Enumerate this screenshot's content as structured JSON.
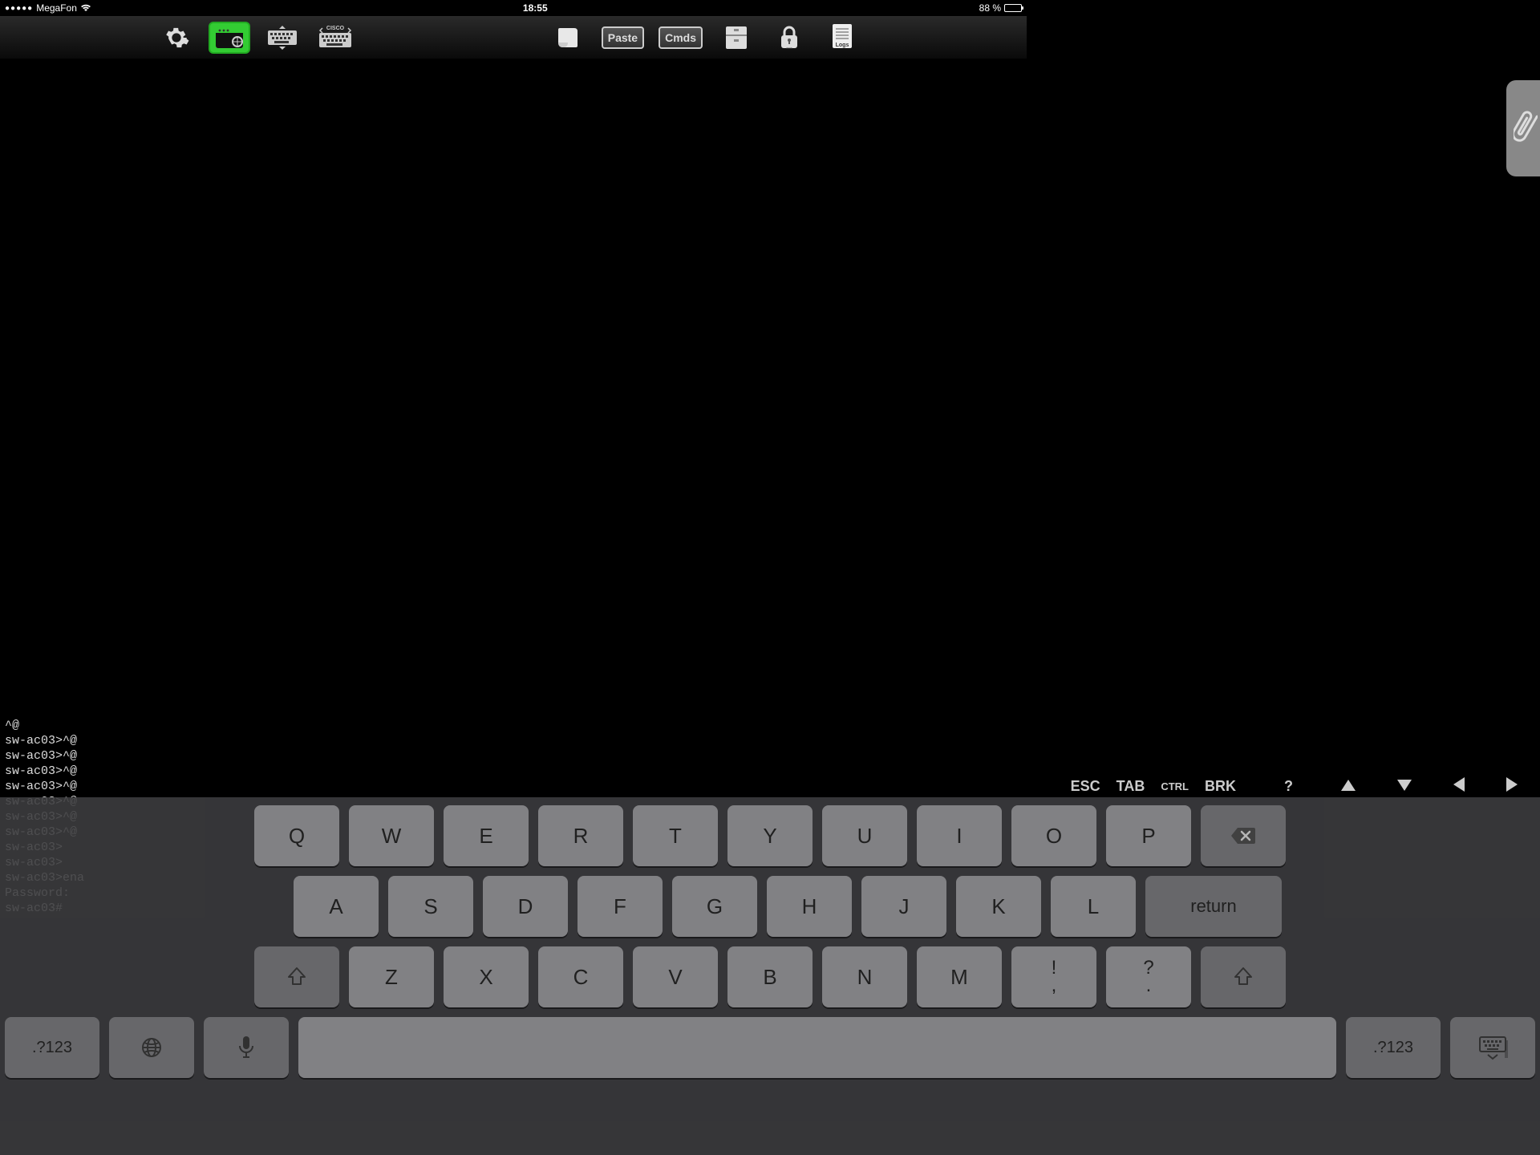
{
  "status": {
    "signal_dots": "●●●●●",
    "carrier": "MegaFon",
    "time": "18:55",
    "battery_pct": "88 %"
  },
  "toolbar": {
    "gear": "settings",
    "terminal": "terminal-session",
    "kbd1": "keyboard",
    "kbd2": "CISCO",
    "script": "script",
    "paste": "Paste",
    "cmds": "Cmds",
    "files": "files",
    "lock": "lock",
    "logs": "Logs"
  },
  "extra_keys": {
    "esc": "ESC",
    "tab": "TAB",
    "ctrl": "CTRL",
    "brk": "BRK",
    "q": "?"
  },
  "terminal_lines": [
    "^@",
    "sw-ac03>^@",
    "sw-ac03>^@",
    "sw-ac03>^@",
    "sw-ac03>^@",
    "sw-ac03>^@",
    "sw-ac03>^@",
    "sw-ac03>^@",
    "sw-ac03>",
    "sw-ac03>",
    "sw-ac03>ena",
    "Password:",
    "sw-ac03#"
  ],
  "keyboard": {
    "row1": [
      "Q",
      "W",
      "E",
      "R",
      "T",
      "Y",
      "U",
      "I",
      "O",
      "P"
    ],
    "row2": [
      "A",
      "S",
      "D",
      "F",
      "G",
      "H",
      "J",
      "K",
      "L"
    ],
    "row3": [
      "Z",
      "X",
      "C",
      "V",
      "B",
      "N",
      "M"
    ],
    "punct1_top": "!",
    "punct1_bot": ",",
    "punct2_top": "?",
    "punct2_bot": ".",
    "return": "return",
    "num": ".?123"
  }
}
